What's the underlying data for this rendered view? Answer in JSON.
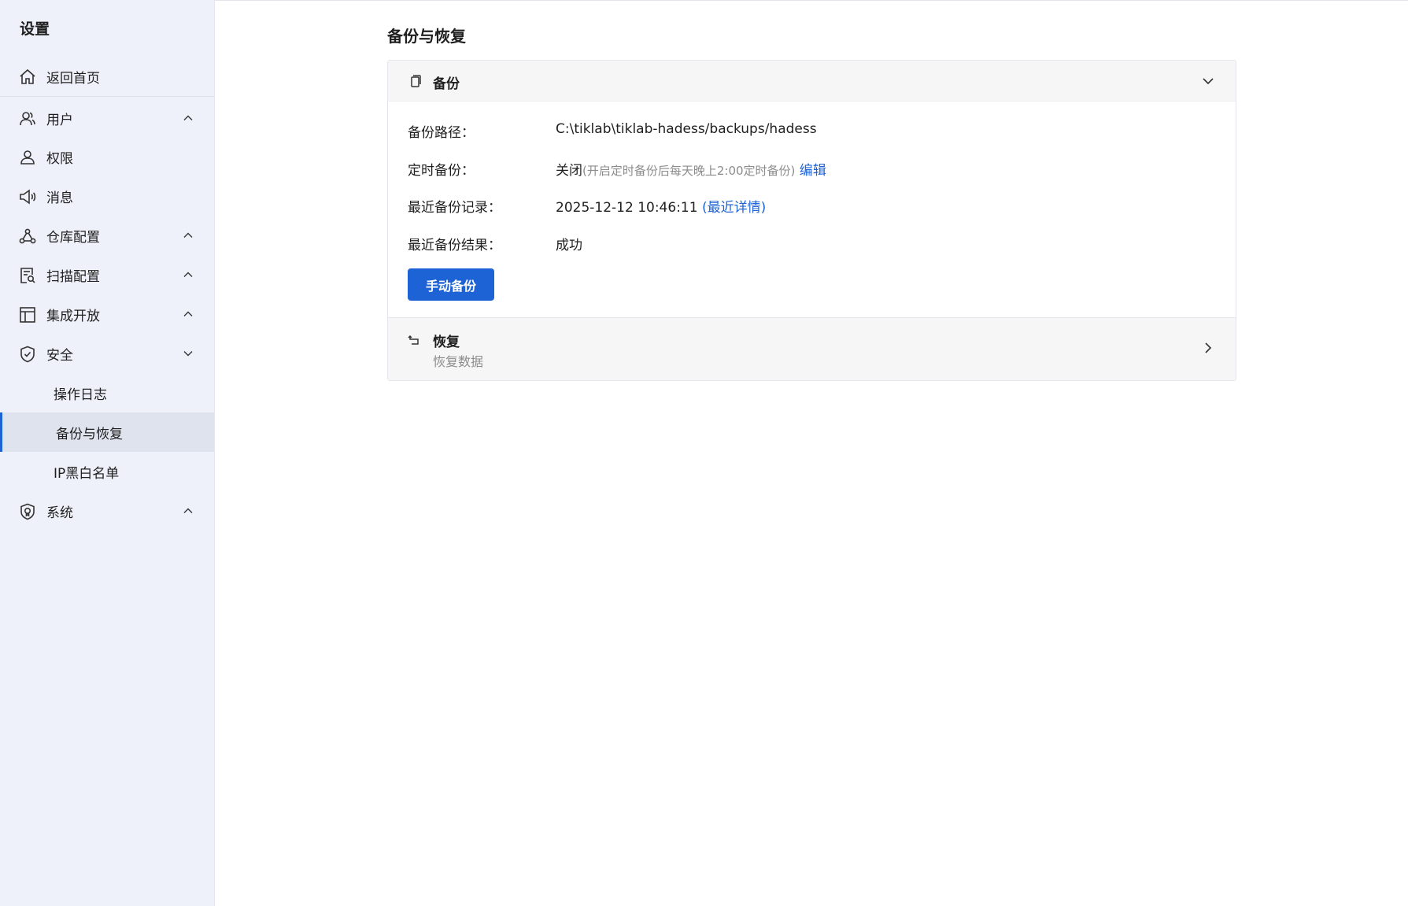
{
  "sidebar": {
    "title": "设置",
    "items": [
      {
        "label": "返回首页",
        "icon": "home-icon"
      },
      {
        "label": "用户",
        "icon": "users-icon",
        "arrow": "chevron-up-icon"
      },
      {
        "label": "权限",
        "icon": "user-icon"
      },
      {
        "label": "消息",
        "icon": "megaphone-icon"
      },
      {
        "label": "仓库配置",
        "icon": "nodes-icon",
        "arrow": "chevron-up-icon"
      },
      {
        "label": "扫描配置",
        "icon": "scan-doc-icon",
        "arrow": "chevron-up-icon"
      },
      {
        "label": "集成开放",
        "icon": "layout-icon",
        "arrow": "chevron-up-icon"
      },
      {
        "label": "安全",
        "icon": "shield-icon",
        "arrow": "chevron-down-icon"
      },
      {
        "label": "操作日志"
      },
      {
        "label": "备份与恢复",
        "active": true
      },
      {
        "label": "IP黑白名单"
      },
      {
        "label": "系统",
        "icon": "certificate-shield-icon",
        "arrow": "chevron-up-icon"
      }
    ]
  },
  "main": {
    "title": "备份与恢复",
    "backup": {
      "title": "备份",
      "path_label": "备份路径：",
      "path_value": "C:\\tiklab\\tiklab-hadess/backups/hadess",
      "schedule_label": "定时备份：",
      "schedule_value": "关闭",
      "schedule_hint": "(开启定时备份后每天晚上2:00定时备份)",
      "schedule_edit": "编辑",
      "recent_label": "最近备份记录：",
      "recent_value": "2025-12-12 10:46:11",
      "recent_link": "(最近详情)",
      "result_label": "最近备份结果：",
      "result_value": "成功",
      "manual_button": "手动备份"
    },
    "restore": {
      "title": "恢复",
      "subtitle": "恢复数据"
    }
  },
  "colors": {
    "accent": "#1e63d6",
    "sidebar_bg": "#eef1f9",
    "muted_text": "#8c8c8c"
  }
}
